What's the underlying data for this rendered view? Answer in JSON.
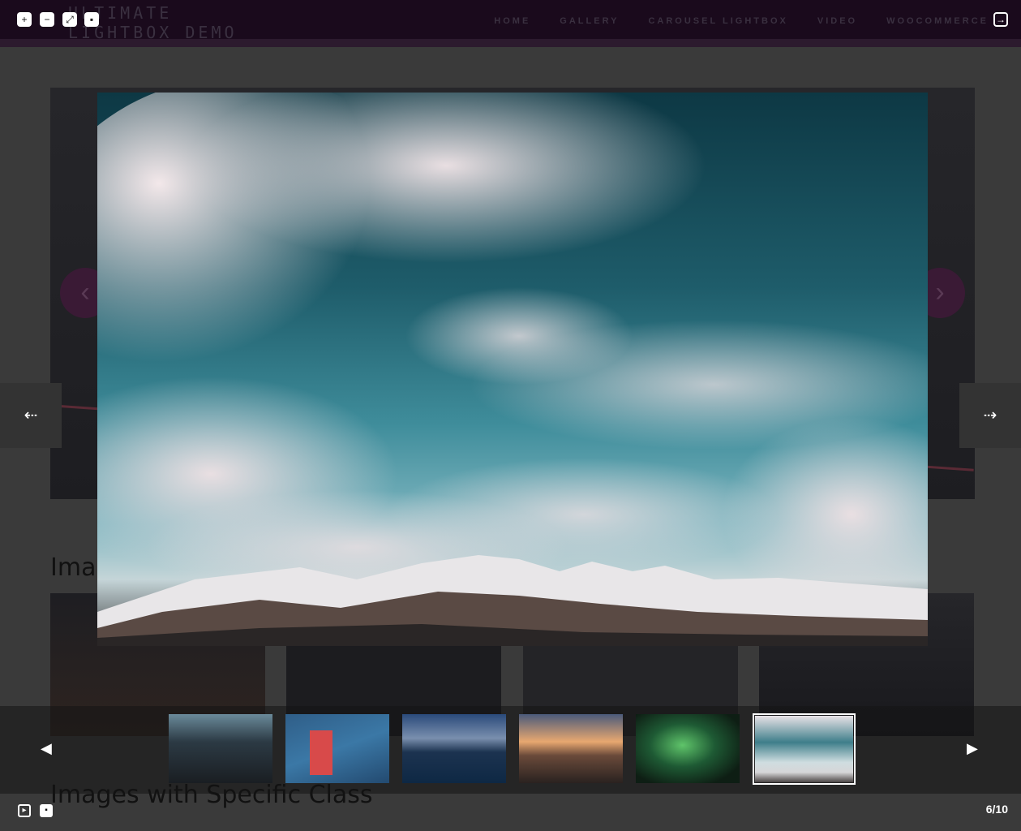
{
  "site": {
    "logo_line1": "ULTIMATE",
    "logo_line2": "LIGHTBOX DEMO",
    "nav": [
      "HOME",
      "GALLERY",
      "CAROUSEL LIGHTBOX",
      "VIDEO",
      "WOOCOMMERCE"
    ],
    "section1_title": "Images",
    "section2_title": "Images with Specific Class"
  },
  "lightbox": {
    "toolbar_icons": [
      "zoom-in-icon",
      "zoom-out-icon",
      "fullscreen-icon",
      "actual-size-icon"
    ],
    "share_icon": "share-icon",
    "prev_glyph": "◀",
    "next_glyph": "▶",
    "side_prev_glyph": "⇠",
    "side_next_glyph": "⇢",
    "bottom_icons": [
      "slideshow-icon",
      "thumbnails-icon"
    ],
    "counter": "6/10",
    "current_index": 6,
    "total": 10,
    "thumbnails": [
      {
        "name": "station-hall-thumb",
        "active": false
      },
      {
        "name": "red-bridge-thumb",
        "active": false
      },
      {
        "name": "city-skyline-thumb",
        "active": false
      },
      {
        "name": "railyard-sunset-thumb",
        "active": false
      },
      {
        "name": "aurora-thumb",
        "active": false
      },
      {
        "name": "snowy-mountains-thumb",
        "active": true
      }
    ]
  },
  "colors": {
    "header_bg": "#1a0a1c",
    "overlay": "#3a3a3a",
    "active_thumb_border": "#ffffff"
  }
}
